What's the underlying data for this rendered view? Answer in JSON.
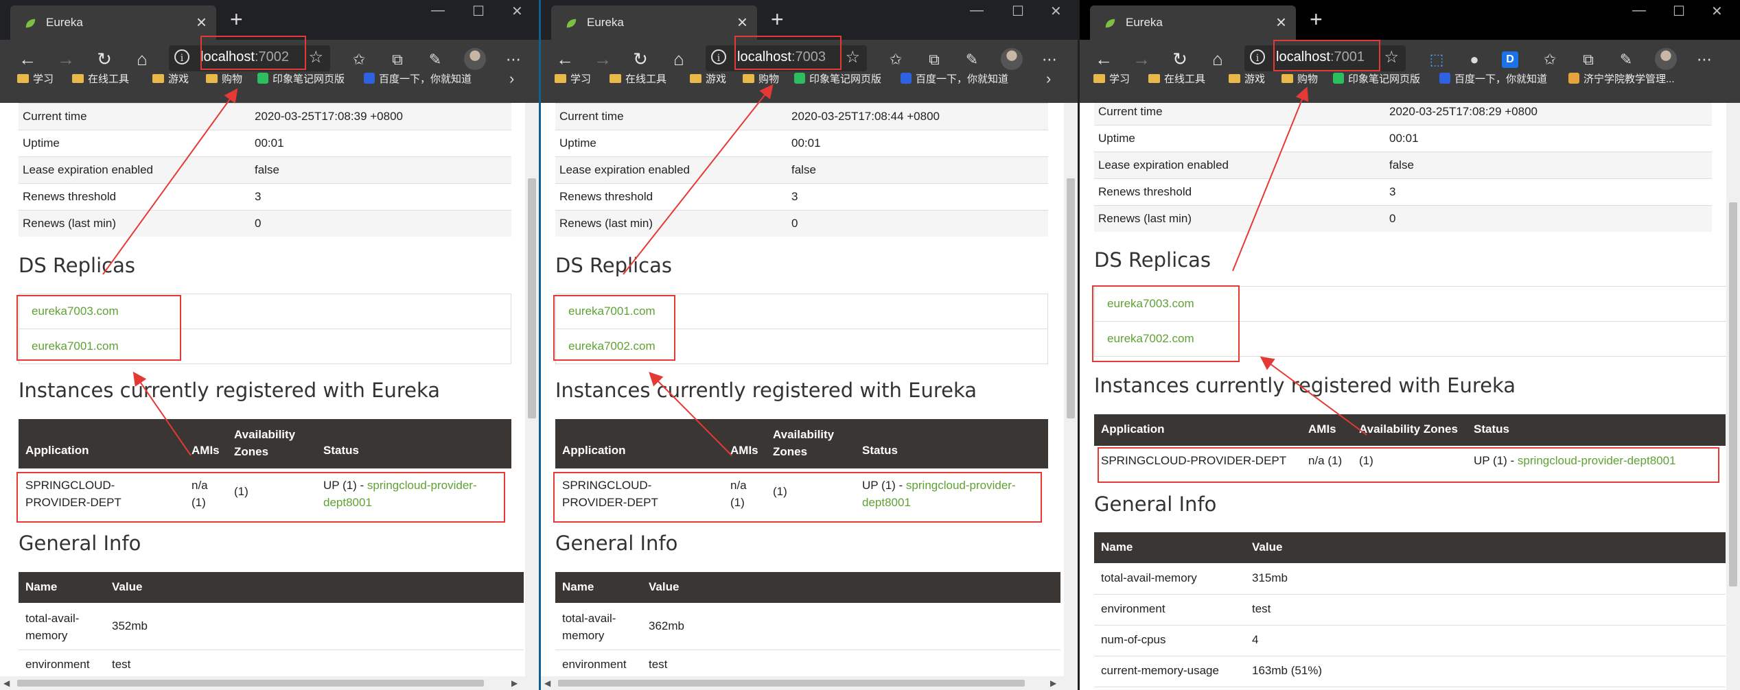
{
  "windows": [
    {
      "tab_title": "Eureka",
      "url_host": "localhost",
      "url_port": ":7002",
      "bookmarks": [
        "学习",
        "在线工具",
        "游戏",
        "购物",
        "印象笔记网页版",
        "百度一下，你就知道"
      ],
      "status": [
        {
          "k": "Current time",
          "v": "2020-03-25T17:08:39 +0800"
        },
        {
          "k": "Uptime",
          "v": "00:01"
        },
        {
          "k": "Lease expiration enabled",
          "v": "false"
        },
        {
          "k": "Renews threshold",
          "v": "3"
        },
        {
          "k": "Renews (last min)",
          "v": "0"
        }
      ],
      "ds_title": "DS Replicas",
      "replicas": [
        "eureka7003.com",
        "eureka7001.com"
      ],
      "inst_title": "Instances currently registered with Eureka",
      "inst_headers": [
        "Application",
        "AMIs",
        "Availability Zones",
        "Status"
      ],
      "instance": {
        "app": "SPRINGCLOUD-PROVIDER-DEPT",
        "amis": "n/a (1)",
        "zones": "(1)",
        "status": "UP (1) - ",
        "link": "springcloud-provider-dept8001"
      },
      "gi_title": "General Info",
      "gi_headers": [
        "Name",
        "Value"
      ],
      "general": [
        {
          "k": "total-avail-memory",
          "v": "352mb"
        },
        {
          "k": "environment",
          "v": "test"
        }
      ]
    },
    {
      "tab_title": "Eureka",
      "url_host": "localhost",
      "url_port": ":7003",
      "bookmarks": [
        "学习",
        "在线工具",
        "游戏",
        "购物",
        "印象笔记网页版",
        "百度一下，你就知道"
      ],
      "status": [
        {
          "k": "Current time",
          "v": "2020-03-25T17:08:44 +0800"
        },
        {
          "k": "Uptime",
          "v": "00:01"
        },
        {
          "k": "Lease expiration enabled",
          "v": "false"
        },
        {
          "k": "Renews threshold",
          "v": "3"
        },
        {
          "k": "Renews (last min)",
          "v": "0"
        }
      ],
      "ds_title": "DS Replicas",
      "replicas": [
        "eureka7001.com",
        "eureka7002.com"
      ],
      "inst_title": "Instances currently registered with Eureka",
      "inst_headers": [
        "Application",
        "AMIs",
        "Availability Zones",
        "Status"
      ],
      "instance": {
        "app": "SPRINGCLOUD-PROVIDER-DEPT",
        "amis": "n/a (1)",
        "zones": "(1)",
        "status": "UP (1) - ",
        "link": "springcloud-provider-dept8001"
      },
      "gi_title": "General Info",
      "gi_headers": [
        "Name",
        "Value"
      ],
      "general": [
        {
          "k": "total-avail-memory",
          "v": "362mb"
        },
        {
          "k": "environment",
          "v": "test"
        }
      ]
    },
    {
      "tab_title": "Eureka",
      "url_host": "localhost",
      "url_port": ":7001",
      "bookmarks": [
        "学习",
        "在线工具",
        "游戏",
        "购物",
        "印象笔记网页版",
        "百度一下，你就知道",
        "济宁学院教学管理..."
      ],
      "status": [
        {
          "k": "Current time",
          "v": "2020-03-25T17:08:29 +0800"
        },
        {
          "k": "Uptime",
          "v": "00:01"
        },
        {
          "k": "Lease expiration enabled",
          "v": "false"
        },
        {
          "k": "Renews threshold",
          "v": "3"
        },
        {
          "k": "Renews (last min)",
          "v": "0"
        }
      ],
      "ds_title": "DS Replicas",
      "replicas": [
        "eureka7003.com",
        "eureka7002.com"
      ],
      "inst_title": "Instances currently registered with Eureka",
      "inst_headers": [
        "Application",
        "AMIs",
        "Availability Zones",
        "Status"
      ],
      "instance": {
        "app": "SPRINGCLOUD-PROVIDER-DEPT",
        "amis": "n/a (1)",
        "zones": "(1)",
        "status": "UP (1) - ",
        "link": "springcloud-provider-dept8001"
      },
      "gi_title": "General Info",
      "gi_headers": [
        "Name",
        "Value"
      ],
      "general": [
        {
          "k": "total-avail-memory",
          "v": "315mb"
        },
        {
          "k": "environment",
          "v": "test"
        },
        {
          "k": "num-of-cpus",
          "v": "4"
        },
        {
          "k": "current-memory-usage",
          "v": "163mb (51%)"
        }
      ]
    }
  ],
  "colors": {
    "accent_green": "#5fa134",
    "header_dark": "#3a3633",
    "annotation_red": "#e53935",
    "chrome_dark": "#3b3b3b"
  },
  "icons": [
    "eureka-leaf-icon",
    "back-icon",
    "forward-icon",
    "refresh-icon",
    "home-icon",
    "info-icon",
    "favorite-star-icon",
    "favorites-icon",
    "collections-icon",
    "feedback-icon",
    "more-icon",
    "folder-icon"
  ]
}
